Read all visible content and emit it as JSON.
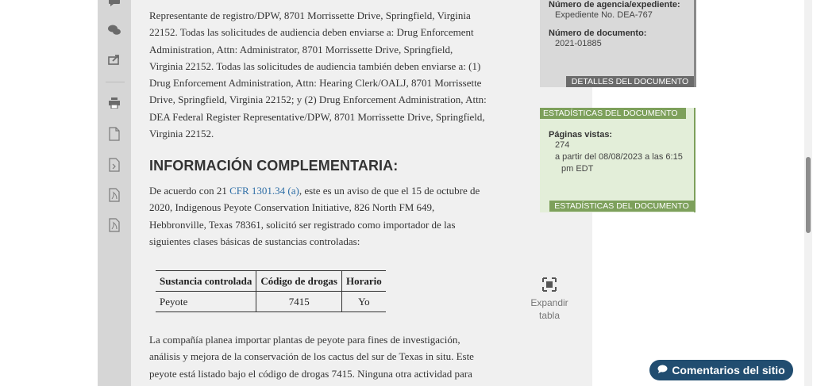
{
  "body": {
    "paragraph_1_lines": [
      "Representante de registro/DPW, 8701 Morrissette Drive, Springfield, Virginia",
      "22152. Todas las solicitudes de audiencia deben enviarse a: Drug Enforcement",
      "Administration, Attn: Administrator, 8701 Morrissette Drive, Springfield,",
      "Virginia 22152. Todas las solicitudes de audiencia también deben enviarse a: (1)",
      "Drug Enforcement Administration, Attn: Hearing Clerk/OALJ, 8701 Morrissette",
      "Drive, Springfield, Virginia 22152; y (2) Drug Enforcement Administration, Attn:",
      "DEA Federal Register Representative/DPW, 8701 Morrissette Drive, Springfield,",
      "Virginia 22152."
    ],
    "section_heading": "INFORMACIÓN COMPLEMENTARIA:",
    "paragraph_2": {
      "line1_before_link": "De acuerdo con 21 ",
      "link_text": "CFR 1301.34 (a)",
      "line1_after_link": ", este es un aviso de que el 15 de octubre de",
      "lines": [
        "2020, Indigenous Peyote Conservation Initiative, 826 North FM 649,",
        "Hebbronville, Texas 78361, solicitó ser registrado como importador de las",
        "siguientes clases básicas de sustancias controladas:"
      ]
    },
    "table": {
      "headers": [
        "Sustancia controlada",
        "Código de drogas",
        "Horario"
      ],
      "rows": [
        [
          "Peyote",
          "7415",
          "Yo"
        ]
      ]
    },
    "paragraph_3_lines": [
      "La compañía planea importar plantas de peyote para fines de investigación,",
      "análisis y mejora de la conservación de los cactus del sur de Texas in situ. Este",
      "peyote está listado bajo el código de drogas 7415. Ninguna otra actividad para"
    ]
  },
  "expand_table": {
    "line1": "Expandir",
    "line2": "tabla",
    "icon": "expand-icon"
  },
  "sidebar": {
    "details": {
      "agency_label": "Número de agencia/expediente:",
      "agency_value": "Expediente No. DEA-767",
      "doc_label": "Número de documento:",
      "doc_value": "2021-01885",
      "band": "DETALLES DEL DOCUMENTO"
    },
    "stats": {
      "band_top": "ESTADÍSTICAS DEL DOCUMENTO",
      "views_label": "Páginas vistas:",
      "views_value": "274",
      "as_of_line1": "a partir del 08/08/2023 a las 6:15",
      "as_of_line2": "pm EDT",
      "band_bottom": "ESTADÍSTICAS DEL DOCUMENTO"
    }
  },
  "feedback": {
    "label": "Comentarios del sitio"
  },
  "colors": {
    "accent_green": "#7da05b",
    "feedback_blue": "#214d70",
    "link_blue": "#2e6ea6"
  }
}
